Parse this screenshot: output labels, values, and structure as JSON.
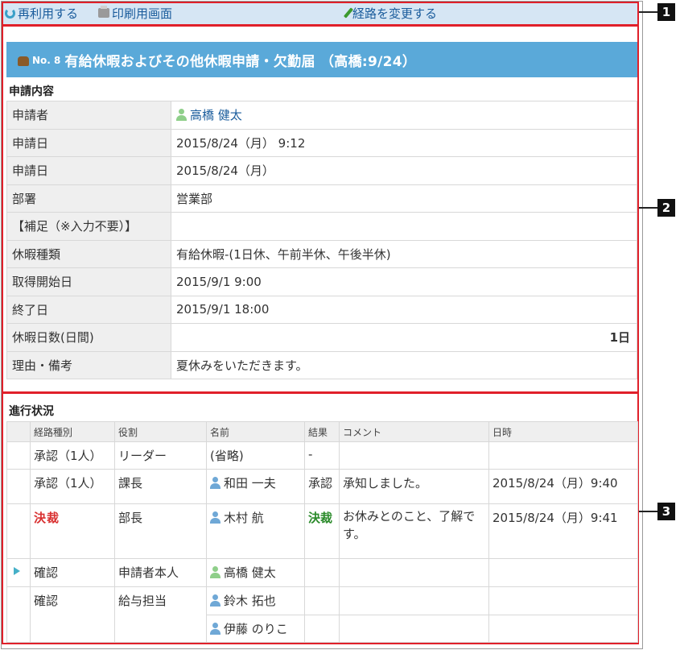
{
  "toolbar": {
    "reuse_label": "再利用する",
    "print_label": "印刷用画面",
    "change_route_label": "経路を変更する"
  },
  "callouts": [
    "1",
    "2",
    "3"
  ],
  "request": {
    "number": "No. 8",
    "title": "有給休暇およびその他休暇申請・欠勤届 （高橋:9/24）"
  },
  "details": {
    "heading": "申請内容",
    "rows": [
      {
        "label": "申請者",
        "value": "高橋 健太"
      },
      {
        "label": "申請日",
        "value": "2015/8/24（月） 9:12"
      },
      {
        "label": "申請日",
        "value": "2015/8/24（月）"
      },
      {
        "label": "部署",
        "value": "営業部"
      },
      {
        "label": "【補足（※入力不要）】",
        "value": ""
      },
      {
        "label": "休暇種類",
        "value": "有給休暇-(1日休、午前半休、午後半休)"
      },
      {
        "label": "取得開始日",
        "value": "2015/9/1 9:00"
      },
      {
        "label": "終了日",
        "value": "2015/9/1 18:00"
      },
      {
        "label": "休暇日数(日間)",
        "value": "1日"
      },
      {
        "label": "理由・備考",
        "value": "夏休みをいただきます。"
      }
    ]
  },
  "progress": {
    "heading": "進行状況",
    "columns": [
      "経路種別",
      "役割",
      "名前",
      "結果",
      "コメント",
      "日時"
    ],
    "rows": [
      {
        "type": "承認（1人）",
        "role": "リーダー",
        "name": "(省略)",
        "result": "-",
        "comment": "",
        "datetime": ""
      },
      {
        "type": "承認（1人）",
        "role": "課長",
        "name": "和田 一夫",
        "result": "承認",
        "comment": "承知しました。",
        "datetime": "2015/8/24（月）9:40"
      },
      {
        "type": "決裁",
        "role": "部長",
        "name": "木村 航",
        "result": "決裁",
        "comment": "お休みとのこと、了解です。",
        "datetime": "2015/8/24（月）9:41"
      },
      {
        "type": "確認",
        "role": "申請者本人",
        "name": "高橋 健太",
        "result": "",
        "comment": "",
        "datetime": ""
      },
      {
        "type": "確認",
        "role": "給与担当",
        "name": "鈴木 拓也",
        "result": "",
        "comment": "",
        "datetime": ""
      },
      {
        "type": "",
        "role": "",
        "name": "伊藤 のりこ",
        "result": "",
        "comment": "",
        "datetime": ""
      }
    ]
  },
  "colors": {
    "title_bar": "#5aa9d9",
    "toolbar_bg": "#d6e6f4",
    "annotation_red": "#e0202a",
    "link_blue": "#1a5c9c",
    "kessai_red": "#d93030",
    "kessai_green": "#2a8a2a"
  }
}
